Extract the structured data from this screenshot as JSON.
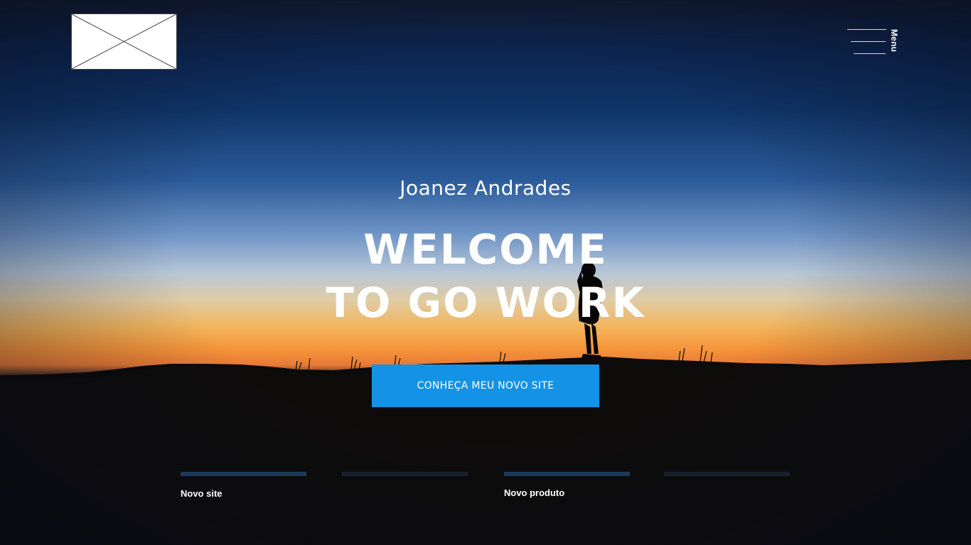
{
  "header": {
    "logo_alt": "",
    "menu_label": "Menu"
  },
  "hero": {
    "subtitle": "Joanez Andrades",
    "headline_line1": "WELCOME",
    "headline_line2": "TO GO WORK",
    "cta_label": "CONHEÇA MEU NOVO SITE"
  },
  "slides": [
    {
      "label": "Novo site",
      "active": true
    },
    {
      "label": "",
      "active": false
    },
    {
      "label": "Novo produto",
      "active": true
    },
    {
      "label": "",
      "active": false
    }
  ],
  "colors": {
    "cta_background": "#1493e6",
    "text": "#ffffff",
    "slide_active": "#1f3a58",
    "slide_inactive": "#17202c"
  },
  "icons": {
    "logo": "image-placeholder-icon",
    "menu": "hamburger-menu-icon"
  }
}
